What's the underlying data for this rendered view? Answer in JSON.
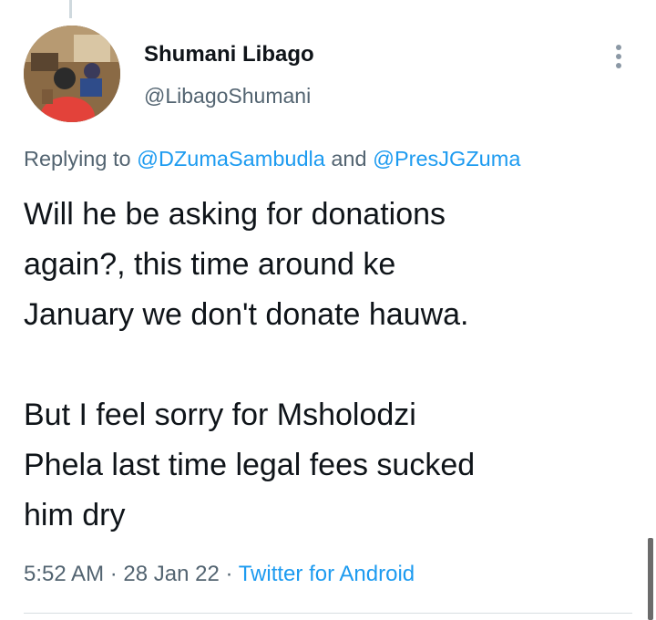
{
  "author": {
    "display_name": "Shumani Libago",
    "handle": "@LibagoShumani"
  },
  "reply": {
    "prefix": "Replying to ",
    "mention_1": "@DZumaSambudla",
    "conjunction": " and ",
    "mention_2": "@PresJGZuma"
  },
  "tweet": {
    "text": "Will he be asking for donations\nagain?, this time around ke\nJanuary we don't donate hauwa.\n\nBut I feel sorry for Msholodzi\nPhela last time legal fees sucked\nhim dry"
  },
  "meta": {
    "time": "5:52 AM",
    "separator": " · ",
    "date": "28 Jan 22",
    "source": "Twitter for Android"
  },
  "colors": {
    "link": "#1d9bf0",
    "secondary_text": "#536471",
    "primary_text": "#0f1419"
  },
  "icons": {
    "more": "more-vertical-icon"
  }
}
